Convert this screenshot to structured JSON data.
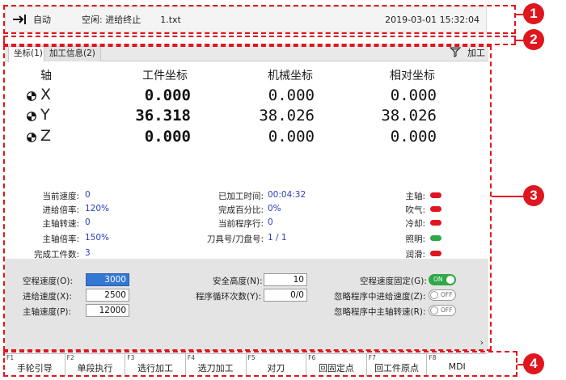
{
  "status": {
    "mode_icon": "arrow-into-bracket-icon",
    "mode": "自动",
    "state": "空闲: 进给终止",
    "file": "1.txt",
    "datetime": "2019-03-01 15:32:04"
  },
  "tabs": {
    "items": [
      "坐标(1)",
      "加工信息(2)"
    ],
    "active": 0,
    "right_icon": "funnel-icon",
    "right_label": "加工"
  },
  "coords": {
    "headers": [
      "轴",
      "工件坐标",
      "机械坐标",
      "相对坐标"
    ],
    "rows": [
      {
        "axis": "X",
        "icon": "pie-icon",
        "work": "0.000",
        "machine": "0.000",
        "relative": "0.000"
      },
      {
        "axis": "Y",
        "icon": "pie-icon",
        "work": "36.318",
        "machine": "38.026",
        "relative": "38.026"
      },
      {
        "axis": "Z",
        "icon": "pie-icon",
        "work": "0.000",
        "machine": "0.000",
        "relative": "0.000"
      }
    ]
  },
  "info_left": [
    {
      "label": "当前速度:",
      "value": "0"
    },
    {
      "label": "进给倍率:",
      "value": "120%"
    },
    {
      "label": "主轴转速:",
      "value": "0"
    },
    {
      "label": "主轴倍率:",
      "value": "150%"
    },
    {
      "label": "完成工件数:",
      "value": "3"
    }
  ],
  "info_mid": [
    {
      "label": "已加工时间:",
      "value": "00:04:32"
    },
    {
      "label": "完成百分比:",
      "value": "0%"
    },
    {
      "label": "当前程序行:",
      "value": "0"
    },
    {
      "label": "刀具号/刀盘号:",
      "value": "1 / 1"
    }
  ],
  "indicators": [
    {
      "label": "主轴:",
      "color": "#e0161f"
    },
    {
      "label": "吹气:",
      "color": "#e0161f"
    },
    {
      "label": "冷却:",
      "color": "#e0161f"
    },
    {
      "label": "照明:",
      "color": "#2fa847"
    },
    {
      "label": "润滑:",
      "color": "#e0161f"
    }
  ],
  "params_left": [
    {
      "label": "空程速度(O):",
      "value": "3000",
      "selected": true
    },
    {
      "label": "进给速度(X):",
      "value": "2500",
      "selected": false
    },
    {
      "label": "主轴速度(P):",
      "value": "12000",
      "selected": false
    }
  ],
  "params_mid": [
    {
      "label": "安全高度(N):",
      "value": "10"
    },
    {
      "label": "程序循环次数(Y):",
      "value": "0/0"
    }
  ],
  "params_right": [
    {
      "label": "空程速度固定(G):",
      "toggle": "ON",
      "state": "on"
    },
    {
      "label": "忽略程序中进给速度(Z):",
      "toggle": "OFF",
      "state": "off"
    },
    {
      "label": "忽略程序中主轴转速(R):",
      "toggle": "OFF",
      "state": "off"
    }
  ],
  "more_icon": "chevron-right-icon",
  "fkeys": [
    {
      "fn": "F1",
      "label": "手轮引导"
    },
    {
      "fn": "F2",
      "label": "单段执行"
    },
    {
      "fn": "F3",
      "label": "选行加工"
    },
    {
      "fn": "F4",
      "label": "选刀加工"
    },
    {
      "fn": "F5",
      "label": "对刀"
    },
    {
      "fn": "F6",
      "label": "回固定点"
    },
    {
      "fn": "F7",
      "label": "回工件原点"
    },
    {
      "fn": "F8",
      "label": "MDI"
    }
  ],
  "annotations": [
    "1",
    "2",
    "3",
    "4"
  ],
  "accent": "#e0161f"
}
